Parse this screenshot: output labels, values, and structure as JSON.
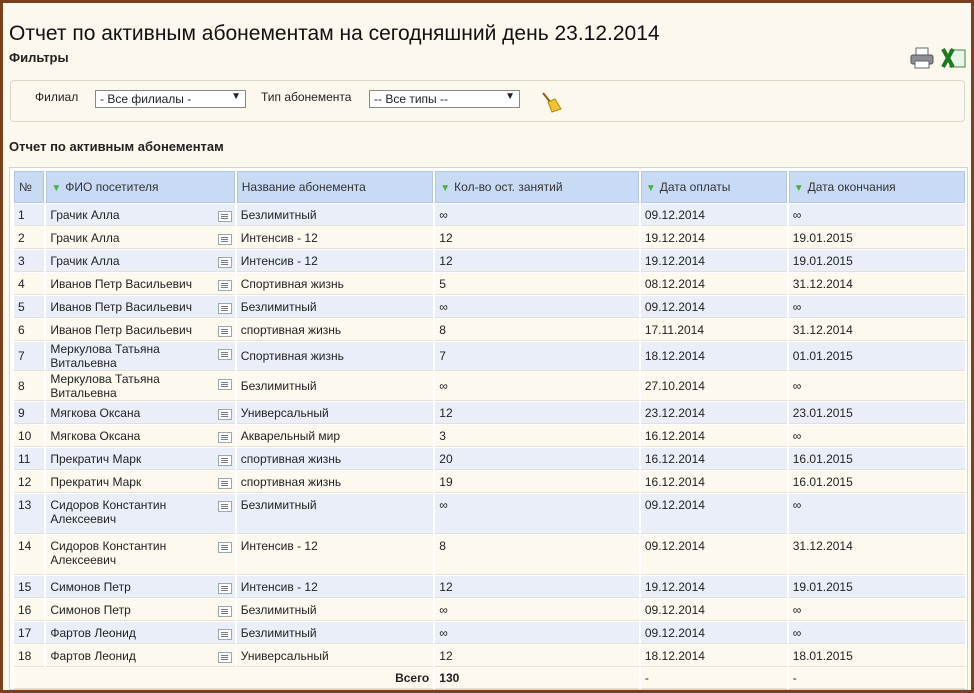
{
  "page": {
    "title": "Отчет по активным абонементам на сегодняшний день 23.12.2014"
  },
  "filters": {
    "heading": "Фильтры",
    "branch_label": "Филиал",
    "branch_value": "- Все филиалы -",
    "type_label": "Тип абонемента",
    "type_value": "-- Все типы --"
  },
  "report": {
    "heading": "Отчет по активным абонементам",
    "columns": [
      "№",
      "ФИО посетителя",
      "Название абонемента",
      "Кол-во ост. занятий",
      "Дата оплаты",
      "Дата окончания"
    ],
    "rows": [
      {
        "n": "1",
        "name": "Грачик Алла",
        "sub": "Безлимитный",
        "left": "∞",
        "paid": "09.12.2014",
        "end": "∞"
      },
      {
        "n": "2",
        "name": "Грачик Алла",
        "sub": "Интенсив - 12",
        "left": "12",
        "paid": "19.12.2014",
        "end": "19.01.2015"
      },
      {
        "n": "3",
        "name": "Грачик Алла",
        "sub": "Интенсив - 12",
        "left": "12",
        "paid": "19.12.2014",
        "end": "19.01.2015"
      },
      {
        "n": "4",
        "name": "Иванов Петр Васильевич",
        "sub": "Спортивная жизнь",
        "left": "5",
        "paid": "08.12.2014",
        "end": "31.12.2014"
      },
      {
        "n": "5",
        "name": "Иванов Петр Васильевич",
        "sub": "Безлимитный",
        "left": "∞",
        "paid": "09.12.2014",
        "end": "∞"
      },
      {
        "n": "6",
        "name": "Иванов Петр Васильевич",
        "sub": "спортивная жизнь",
        "left": "8",
        "paid": "17.11.2014",
        "end": "31.12.2014"
      },
      {
        "n": "7",
        "name": "Меркулова Татьяна Витальевна",
        "sub": "Спортивная жизнь",
        "left": "7",
        "paid": "18.12.2014",
        "end": "01.01.2015"
      },
      {
        "n": "8",
        "name": "Меркулова Татьяна Витальевна",
        "sub": "Безлимитный",
        "left": "∞",
        "paid": "27.10.2014",
        "end": "∞"
      },
      {
        "n": "9",
        "name": "Мягкова Оксана",
        "sub": "Универсальный",
        "left": "12",
        "paid": "23.12.2014",
        "end": "23.01.2015"
      },
      {
        "n": "10",
        "name": "Мягкова Оксана",
        "sub": "Акварельный мир",
        "left": "3",
        "paid": "16.12.2014",
        "end": "∞"
      },
      {
        "n": "11",
        "name": "Прекратич Марк",
        "sub": "спортивная жизнь",
        "left": "20",
        "paid": "16.12.2014",
        "end": "16.01.2015"
      },
      {
        "n": "12",
        "name": "Прекратич Марк",
        "sub": "спортивная жизнь",
        "left": "19",
        "paid": "16.12.2014",
        "end": "16.01.2015"
      },
      {
        "n": "13",
        "name": "Сидоров Константин Алексеевич",
        "sub": "Безлимитный",
        "left": "∞",
        "paid": "09.12.2014",
        "end": "∞"
      },
      {
        "n": "14",
        "name": "Сидоров Константин Алексеевич",
        "sub": "Интенсив - 12",
        "left": "8",
        "paid": "09.12.2014",
        "end": "31.12.2014"
      },
      {
        "n": "15",
        "name": "Симонов Петр",
        "sub": "Интенсив - 12",
        "left": "12",
        "paid": "19.12.2014",
        "end": "19.01.2015"
      },
      {
        "n": "16",
        "name": "Симонов Петр",
        "sub": "Безлимитный",
        "left": "∞",
        "paid": "09.12.2014",
        "end": "∞"
      },
      {
        "n": "17",
        "name": "Фартов Леонид",
        "sub": "Безлимитный",
        "left": "∞",
        "paid": "09.12.2014",
        "end": "∞"
      },
      {
        "n": "18",
        "name": "Фартов Леонид",
        "sub": "Универсальный",
        "left": "12",
        "paid": "18.12.2014",
        "end": "18.01.2015"
      }
    ],
    "total": {
      "label": "Всего",
      "left": "130",
      "paid": "-",
      "end": "-"
    }
  },
  "icons": {
    "print": "printer-icon",
    "excel": "excel-icon",
    "clear": "broom-icon",
    "note": "note-icon",
    "sort": "sort-arrow-icon"
  },
  "colors": {
    "frame": "#7a3f1d",
    "header_bg": "#c9daf5",
    "row_alt": "#e9eef8",
    "sort_arrow": "#4caf3d"
  }
}
